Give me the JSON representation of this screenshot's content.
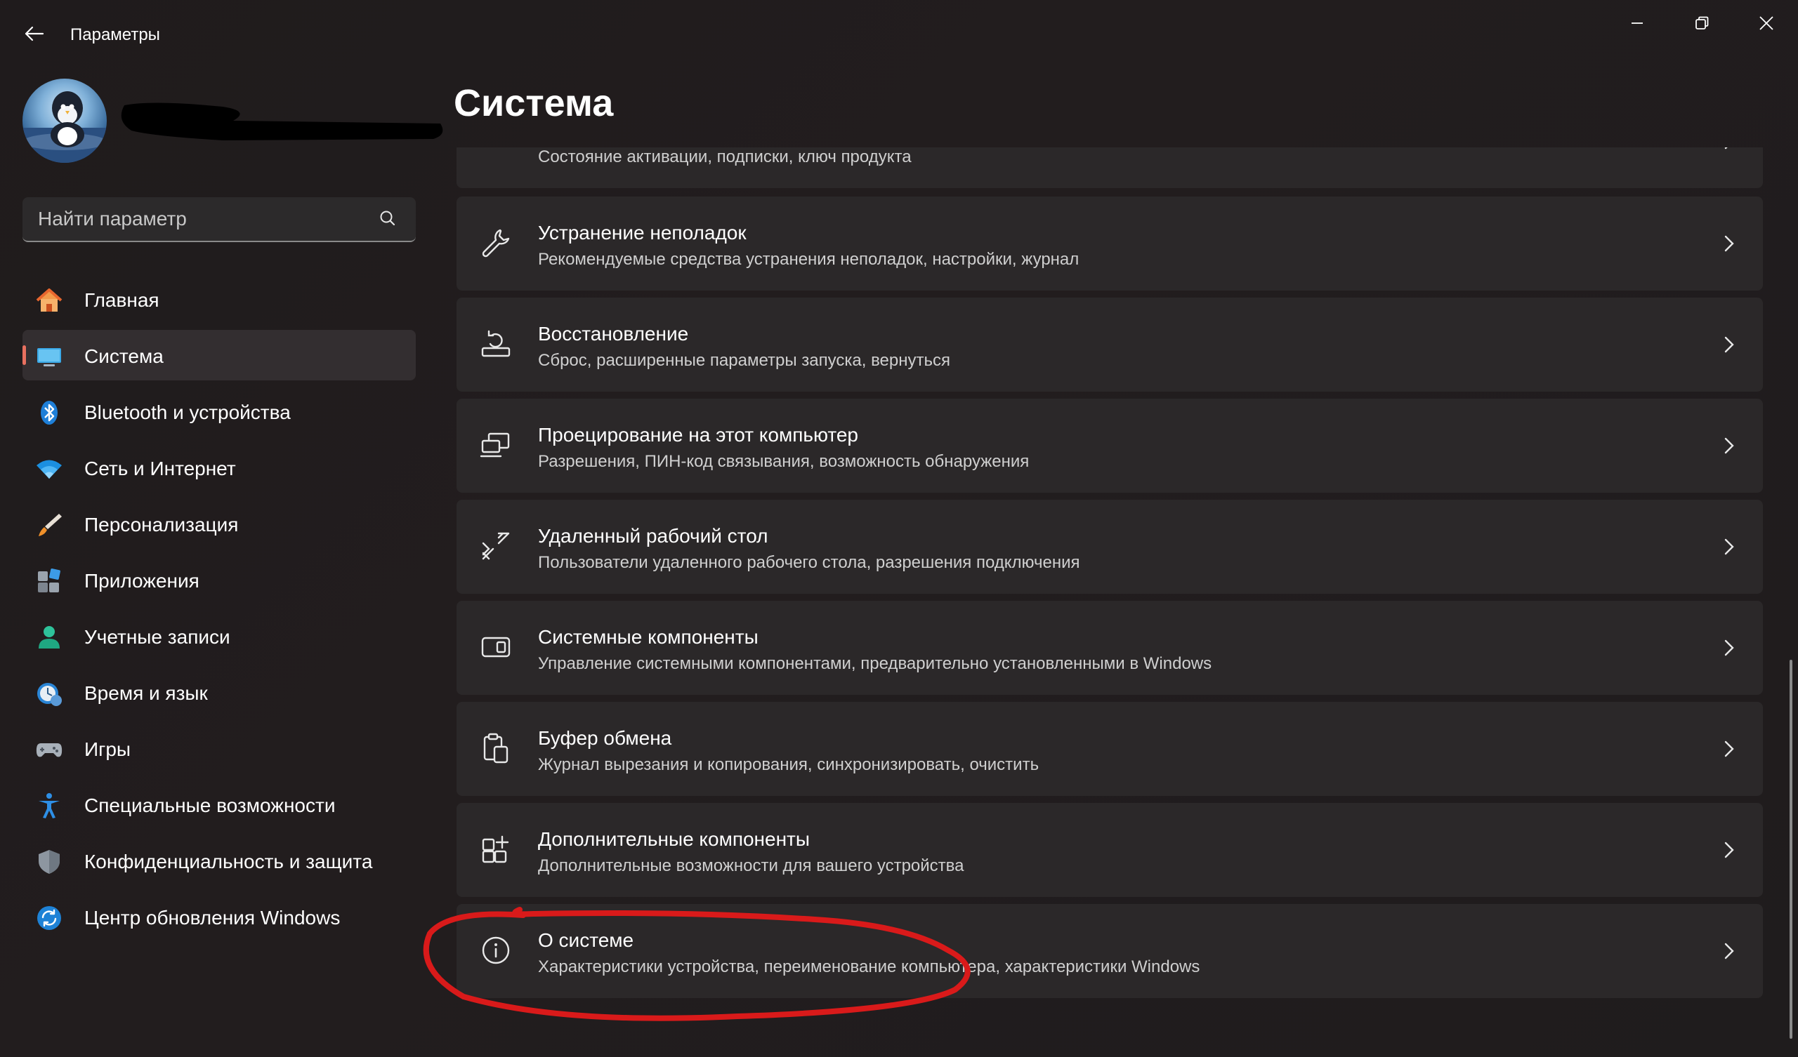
{
  "window": {
    "title": "Параметры",
    "controls": [
      "minimize",
      "maximize",
      "close"
    ]
  },
  "search": {
    "placeholder": "Найти параметр"
  },
  "sidebar": {
    "items": [
      {
        "label": "Главная",
        "icon": "home-icon",
        "active": false
      },
      {
        "label": "Система",
        "icon": "system-icon",
        "active": true
      },
      {
        "label": "Bluetooth и устройства",
        "icon": "bluetooth-icon",
        "active": false
      },
      {
        "label": "Сеть и Интернет",
        "icon": "wifi-icon",
        "active": false
      },
      {
        "label": "Персонализация",
        "icon": "brush-icon",
        "active": false
      },
      {
        "label": "Приложения",
        "icon": "apps-icon",
        "active": false
      },
      {
        "label": "Учетные записи",
        "icon": "account-icon",
        "active": false
      },
      {
        "label": "Время и язык",
        "icon": "time-language-icon",
        "active": false
      },
      {
        "label": "Игры",
        "icon": "gamepad-icon",
        "active": false
      },
      {
        "label": "Специальные возможности",
        "icon": "accessibility-icon",
        "active": false
      },
      {
        "label": "Конфиденциальность и защита",
        "icon": "shield-icon",
        "active": false
      },
      {
        "label": "Центр обновления Windows",
        "icon": "update-icon",
        "active": false
      }
    ]
  },
  "main": {
    "title": "Система",
    "cards": [
      {
        "title": "",
        "subtitle": "Состояние активации, подписки, ключ продукта",
        "icon": "activation-icon"
      },
      {
        "title": "Устранение неполадок",
        "subtitle": "Рекомендуемые средства устранения неполадок, настройки, журнал",
        "icon": "wrench-icon"
      },
      {
        "title": "Восстановление",
        "subtitle": "Сброс, расширенные параметры запуска, вернуться",
        "icon": "recovery-icon"
      },
      {
        "title": "Проецирование на этот компьютер",
        "subtitle": "Разрешения, ПИН-код связывания, возможность обнаружения",
        "icon": "projection-icon"
      },
      {
        "title": "Удаленный рабочий стол",
        "subtitle": "Пользователи удаленного рабочего стола, разрешения подключения",
        "icon": "remote-desktop-icon"
      },
      {
        "title": "Системные компоненты",
        "subtitle": "Управление системными компонентами, предварительно установленными в Windows",
        "icon": "system-components-icon"
      },
      {
        "title": "Буфер обмена",
        "subtitle": "Журнал вырезания и копирования, синхронизировать, очистить",
        "icon": "clipboard-icon"
      },
      {
        "title": "Дополнительные компоненты",
        "subtitle": "Дополнительные возможности для вашего устройства",
        "icon": "optional-features-icon"
      },
      {
        "title": "О системе",
        "subtitle": "Характеристики устройства, переименование компьютера, характеристики Windows",
        "icon": "info-icon"
      }
    ]
  },
  "colors": {
    "accent": "#e8705f",
    "annotation": "#d91a1a",
    "card_bg": "#2b2829",
    "background": "#201c1d"
  }
}
